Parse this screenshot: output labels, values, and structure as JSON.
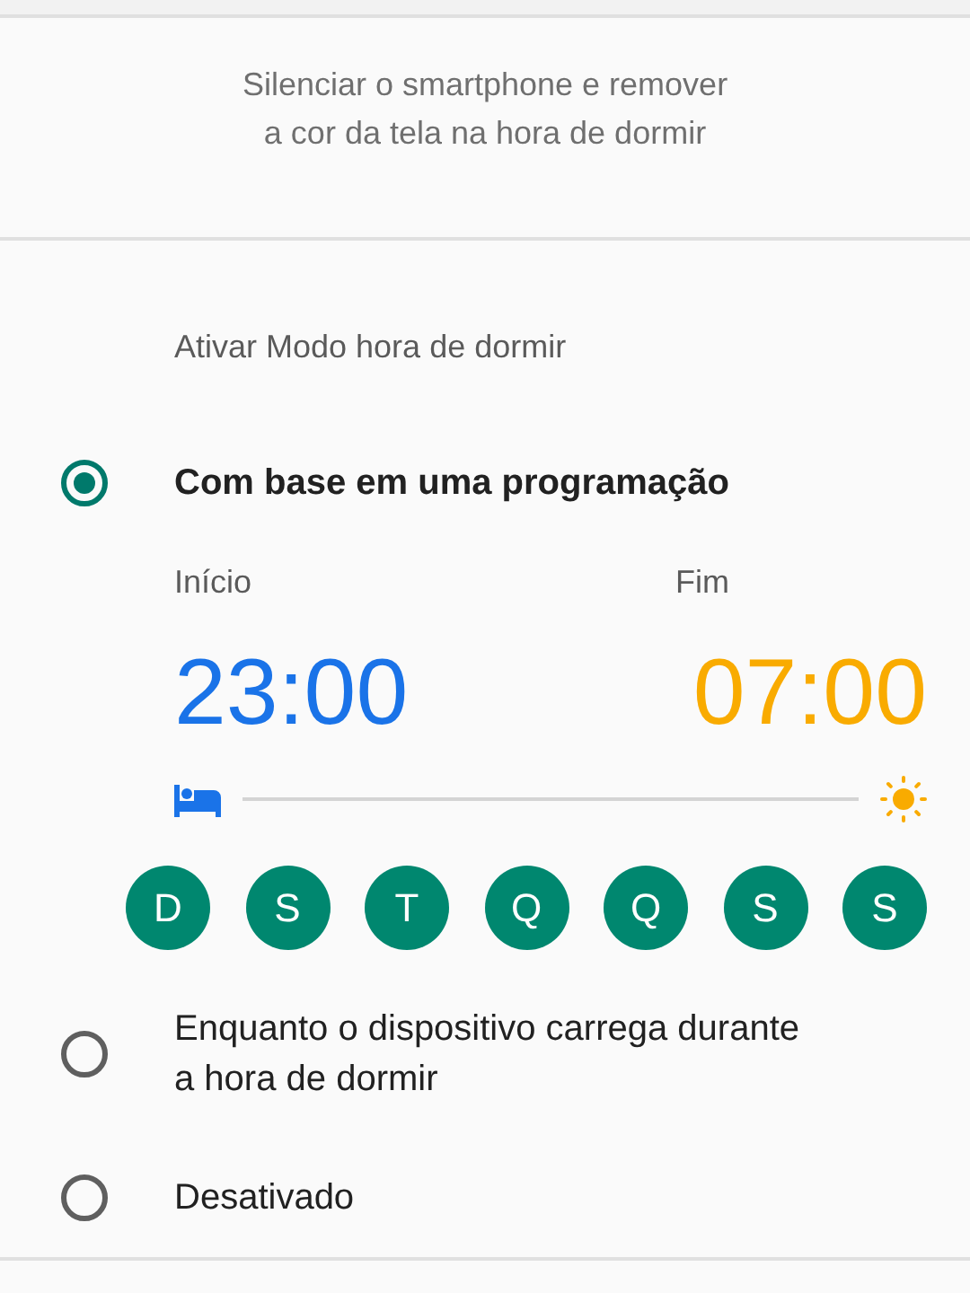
{
  "description": "Silenciar o smartphone e remover a cor da tela na hora de dormir",
  "section_title": "Ativar Modo hora de dormir",
  "options": [
    {
      "kind": "schedule",
      "label": "Com base em uma programação",
      "selected": true,
      "start_label": "Início",
      "start_time": "23:00",
      "end_label": "Fim",
      "end_time": "07:00",
      "days": [
        {
          "label": "D",
          "selected": true
        },
        {
          "label": "S",
          "selected": true
        },
        {
          "label": "T",
          "selected": true
        },
        {
          "label": "Q",
          "selected": true
        },
        {
          "label": "Q",
          "selected": true
        },
        {
          "label": "S",
          "selected": true
        },
        {
          "label": "S",
          "selected": true
        }
      ]
    },
    {
      "kind": "plain",
      "label": "Enquanto o dispositivo carrega durante a hora de dormir",
      "selected": false
    },
    {
      "kind": "plain",
      "label": "Desativado",
      "selected": false
    }
  ]
}
